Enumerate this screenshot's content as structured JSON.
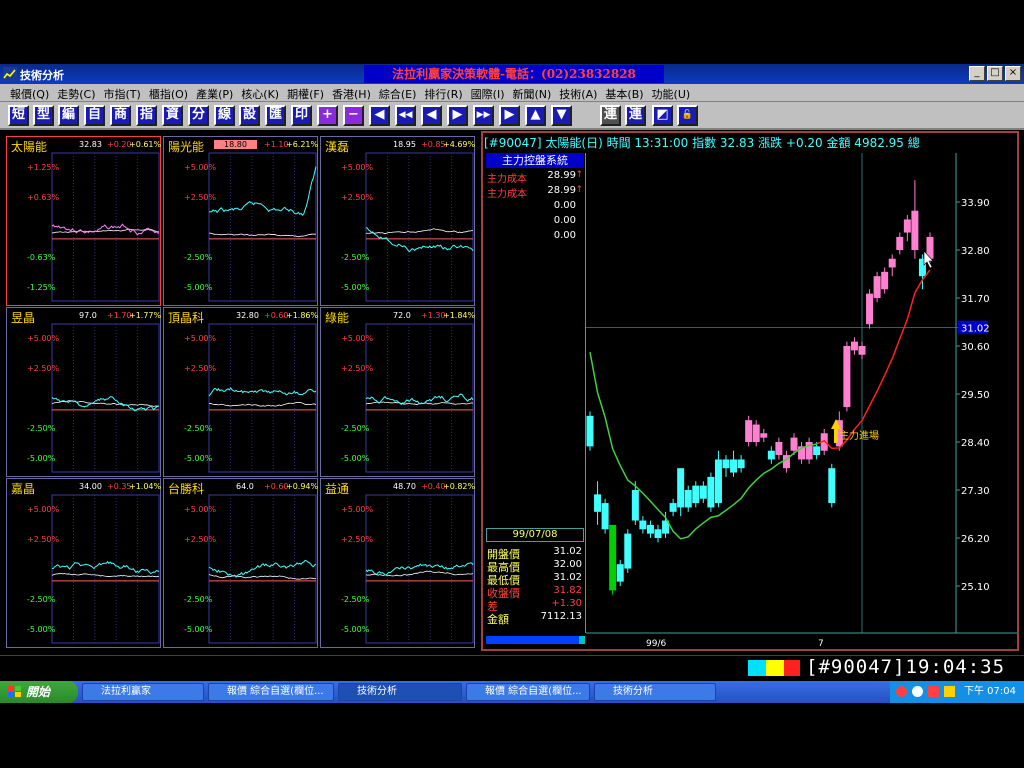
{
  "window": {
    "title": "技術分析",
    "banner": "法拉利贏家決策軟體-電話：(02)23832828",
    "controls": [
      "_",
      "□",
      "×"
    ]
  },
  "menu": [
    "報價(Q)",
    "走勢(C)",
    "市指(T)",
    "櫃指(O)",
    "產業(P)",
    "核心(K)",
    "期權(F)",
    "香港(H)",
    "綜合(E)",
    "排行(R)",
    "國際(I)",
    "新聞(N)",
    "技術(A)",
    "基本(B)",
    "功能(U)"
  ],
  "toolbar": [
    "短",
    "型",
    "編",
    "自",
    "商",
    "指",
    "資",
    "分",
    "線",
    "設",
    "匯",
    "印",
    "+",
    "−",
    "◀",
    "◀◀",
    "◀",
    "▶",
    "▶▶",
    "▶",
    "▲",
    "▼",
    "連",
    "連",
    "◩",
    "🔓"
  ],
  "panels": [
    {
      "name": "太陽能",
      "price": "32.83",
      "chg": "+0.20",
      "pct": "+0.61%",
      "ticks": [
        "+1.25%",
        "+0.63%",
        "-0.63%",
        "-1.25%"
      ]
    },
    {
      "name": "陽光能",
      "price": "18.80",
      "chg": "+1.10",
      "pct": "+6.21%",
      "ticks": [
        "+5.00%",
        "+2.50%",
        "-2.50%",
        "-5.00%"
      ]
    },
    {
      "name": "漢磊",
      "price": "18.95",
      "chg": "+0.85",
      "pct": "+4.69%",
      "ticks": [
        "+5.00%",
        "+2.50%",
        "-2.50%",
        "-5.00%"
      ]
    },
    {
      "name": "昱晶",
      "price": "97.0",
      "chg": "+1.70",
      "pct": "+1.77%",
      "ticks": [
        "+5.00%",
        "+2.50%",
        "-2.50%",
        "-5.00%"
      ]
    },
    {
      "name": "頂晶科",
      "price": "32.80",
      "chg": "+0.60",
      "pct": "+1.86%",
      "ticks": [
        "+5.00%",
        "+2.50%",
        "-2.50%",
        "-5.00%"
      ]
    },
    {
      "name": "綠能",
      "price": "72.0",
      "chg": "+1.30",
      "pct": "+1.84%",
      "ticks": [
        "+5.00%",
        "+2.50%",
        "-2.50%",
        "-5.00%"
      ]
    },
    {
      "name": "嘉晶",
      "price": "34.00",
      "chg": "+0.35",
      "pct": "+1.04%",
      "ticks": [
        "+5.00%",
        "+2.50%",
        "-2.50%",
        "-5.00%"
      ]
    },
    {
      "name": "台勝科",
      "price": "64.0",
      "chg": "+0.60",
      "pct": "+0.94%",
      "ticks": [
        "+5.00%",
        "+2.50%",
        "-2.50%",
        "-5.00%"
      ]
    },
    {
      "name": "益通",
      "price": "48.70",
      "chg": "+0.40",
      "pct": "+0.82%",
      "ticks": [
        "+5.00%",
        "+2.50%",
        "-2.50%",
        "-5.00%"
      ]
    }
  ],
  "main": {
    "header": "[#90047] 太陽能(日)  時間 13:31:00  指數 32.83  漲跌 +0.20  金額 4982.95  總",
    "system_title": "主力控盤系統",
    "system_rows": [
      {
        "label": "主力成本",
        "value": "28.99",
        "arrow": "↑"
      },
      {
        "label": "主力成本",
        "value": "28.99",
        "arrow": "↑"
      },
      {
        "label": "",
        "value": "0.00",
        "arrow": ""
      },
      {
        "label": "",
        "value": "0.00",
        "arrow": ""
      },
      {
        "label": "",
        "value": "0.00",
        "arrow": ""
      }
    ],
    "date": "99/07/08",
    "ohlc": [
      {
        "label": "開盤價",
        "value": "31.02"
      },
      {
        "label": "最高價",
        "value": "32.00"
      },
      {
        "label": "最低價",
        "value": "31.02"
      },
      {
        "label": "收盤價",
        "value": "31.82"
      },
      {
        "label": "差",
        "value": "+1.30"
      },
      {
        "label": "金額",
        "value": "7112.13"
      }
    ],
    "y_ticks": [
      "33.90",
      "32.80",
      "31.70",
      "30.60",
      "29.50",
      "28.40",
      "27.30",
      "26.20",
      "25.10"
    ],
    "current_price_label": "31.02",
    "x_labels": [
      "99/6",
      "7"
    ],
    "annotation": "主力進場"
  },
  "status": {
    "clock": "[#90047]19:04:35"
  },
  "taskbar": {
    "start": "開始",
    "tasks": [
      "法拉利贏家",
      "報價 綜合自選(欄位...",
      "技術分析",
      "報價 綜合自選(欄位...",
      "技術分析"
    ],
    "time": "下午 07:04"
  },
  "chart_data": {
    "type": "candlestick",
    "y_range": [
      25.1,
      33.9
    ],
    "y_ticks": [
      33.9,
      32.8,
      31.7,
      30.6,
      29.5,
      28.4,
      27.3,
      26.2,
      25.1
    ],
    "x_labels": [
      "99/6",
      "7"
    ],
    "candles": [
      {
        "o": 29.0,
        "c": 28.3,
        "h": 29.1,
        "l": 28.2,
        "dir": "down"
      },
      {
        "o": 27.2,
        "c": 26.8,
        "h": 27.5,
        "l": 26.5,
        "dir": "down"
      },
      {
        "o": 27.0,
        "c": 26.4,
        "h": 27.1,
        "l": 26.3,
        "dir": "down"
      },
      {
        "o": 26.5,
        "c": 25.0,
        "h": 26.5,
        "l": 24.9,
        "dir": "up"
      },
      {
        "o": 25.2,
        "c": 25.6,
        "h": 25.7,
        "l": 25.1,
        "dir": "down"
      },
      {
        "o": 26.3,
        "c": 25.5,
        "h": 26.4,
        "l": 25.4,
        "dir": "down"
      },
      {
        "o": 27.3,
        "c": 26.6,
        "h": 27.5,
        "l": 26.5,
        "dir": "down"
      },
      {
        "o": 26.6,
        "c": 26.4,
        "h": 26.7,
        "l": 26.3,
        "dir": "down"
      },
      {
        "o": 26.5,
        "c": 26.3,
        "h": 26.6,
        "l": 26.2,
        "dir": "down"
      },
      {
        "o": 26.4,
        "c": 26.2,
        "h": 26.5,
        "l": 26.1,
        "dir": "down"
      },
      {
        "o": 26.6,
        "c": 26.3,
        "h": 26.8,
        "l": 26.2,
        "dir": "down"
      },
      {
        "o": 27.0,
        "c": 26.8,
        "h": 27.1,
        "l": 26.7,
        "dir": "down"
      },
      {
        "o": 27.8,
        "c": 26.9,
        "h": 27.8,
        "l": 26.7,
        "dir": "down"
      },
      {
        "o": 27.3,
        "c": 26.9,
        "h": 27.4,
        "l": 26.8,
        "dir": "down"
      },
      {
        "o": 27.4,
        "c": 27.0,
        "h": 27.5,
        "l": 26.9,
        "dir": "down"
      },
      {
        "o": 27.4,
        "c": 27.1,
        "h": 27.5,
        "l": 27.0,
        "dir": "down"
      },
      {
        "o": 27.6,
        "c": 26.9,
        "h": 27.7,
        "l": 26.8,
        "dir": "down"
      },
      {
        "o": 28.0,
        "c": 27.0,
        "h": 28.2,
        "l": 26.9,
        "dir": "down"
      },
      {
        "o": 28.0,
        "c": 27.8,
        "h": 28.1,
        "l": 27.6,
        "dir": "down"
      },
      {
        "o": 28.0,
        "c": 27.7,
        "h": 28.2,
        "l": 27.6,
        "dir": "down"
      },
      {
        "o": 28.0,
        "c": 27.8,
        "h": 28.1,
        "l": 27.7,
        "dir": "down"
      },
      {
        "o": 28.4,
        "c": 28.9,
        "h": 29.0,
        "l": 28.3,
        "dir": "up"
      },
      {
        "o": 28.4,
        "c": 28.8,
        "h": 28.9,
        "l": 28.3,
        "dir": "up"
      },
      {
        "o": 28.5,
        "c": 28.6,
        "h": 28.7,
        "l": 28.4,
        "dir": "up"
      },
      {
        "o": 28.2,
        "c": 28.0,
        "h": 28.3,
        "l": 27.9,
        "dir": "down"
      },
      {
        "o": 28.1,
        "c": 28.4,
        "h": 28.5,
        "l": 28.0,
        "dir": "up"
      },
      {
        "o": 27.8,
        "c": 28.1,
        "h": 28.2,
        "l": 27.7,
        "dir": "up"
      },
      {
        "o": 28.2,
        "c": 28.5,
        "h": 28.6,
        "l": 28.1,
        "dir": "up"
      },
      {
        "o": 28.0,
        "c": 28.3,
        "h": 28.4,
        "l": 27.9,
        "dir": "up"
      },
      {
        "o": 28.0,
        "c": 28.4,
        "h": 28.5,
        "l": 27.9,
        "dir": "up"
      },
      {
        "o": 28.3,
        "c": 28.1,
        "h": 28.4,
        "l": 28.0,
        "dir": "down"
      },
      {
        "o": 28.2,
        "c": 28.6,
        "h": 28.7,
        "l": 28.1,
        "dir": "up"
      },
      {
        "o": 27.8,
        "c": 27.0,
        "h": 27.9,
        "l": 26.9,
        "dir": "down"
      },
      {
        "o": 28.3,
        "c": 28.9,
        "h": 29.1,
        "l": 28.2,
        "dir": "up"
      },
      {
        "o": 29.2,
        "c": 30.6,
        "h": 30.7,
        "l": 29.1,
        "dir": "up"
      },
      {
        "o": 30.5,
        "c": 30.7,
        "h": 30.8,
        "l": 30.4,
        "dir": "up"
      },
      {
        "o": 30.4,
        "c": 30.6,
        "h": 30.7,
        "l": 30.3,
        "dir": "up"
      },
      {
        "o": 31.1,
        "c": 31.8,
        "h": 31.9,
        "l": 31.0,
        "dir": "up"
      },
      {
        "o": 31.7,
        "c": 32.2,
        "h": 32.3,
        "l": 31.6,
        "dir": "up"
      },
      {
        "o": 31.9,
        "c": 32.3,
        "h": 32.4,
        "l": 31.8,
        "dir": "up"
      },
      {
        "o": 32.4,
        "c": 32.6,
        "h": 32.7,
        "l": 32.2,
        "dir": "up"
      },
      {
        "o": 32.8,
        "c": 33.1,
        "h": 33.2,
        "l": 32.7,
        "dir": "up"
      },
      {
        "o": 33.2,
        "c": 33.5,
        "h": 33.6,
        "l": 33.0,
        "dir": "up"
      },
      {
        "o": 32.8,
        "c": 33.7,
        "h": 34.4,
        "l": 32.6,
        "dir": "up"
      },
      {
        "o": 32.6,
        "c": 32.2,
        "h": 32.7,
        "l": 31.9,
        "dir": "down"
      },
      {
        "o": 32.6,
        "c": 33.1,
        "h": 33.2,
        "l": 32.5,
        "dir": "up"
      }
    ],
    "ma_line": {
      "color_down": "#40d040",
      "color_up": "#ff2020"
    }
  }
}
